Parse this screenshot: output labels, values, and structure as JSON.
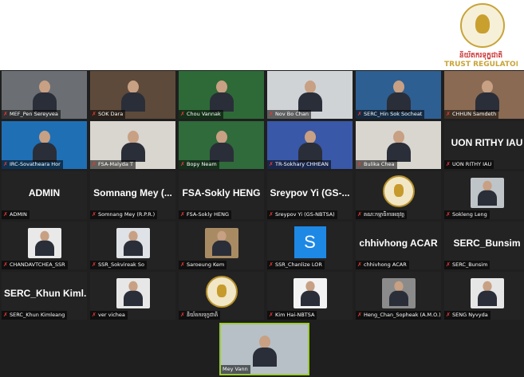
{
  "logo": {
    "kh_text": "និយ័តករទុក្ខជាតិ",
    "en_text": "TRUST REGULATOR",
    "brand_color": "#c8a43a"
  },
  "participants": [
    {
      "name": "MEF_Pen Sereyvea",
      "kind": "video",
      "bg": "#6b6f74"
    },
    {
      "name": "SOK Dara",
      "kind": "video",
      "bg": "#5e4a3a"
    },
    {
      "name": "Chou Vannak",
      "kind": "video",
      "bg": "#2e6a37"
    },
    {
      "name": "Nov Bo Chan",
      "kind": "video",
      "bg": "#cfd3d6"
    },
    {
      "name": "SERC_Hin Sok Socheat",
      "kind": "video",
      "bg": "#2e5f92"
    },
    {
      "name": "CHHUN Samdeth",
      "kind": "video",
      "bg": "#8a6a52"
    },
    {
      "name": "IRC-Sovatheara Hor",
      "kind": "video",
      "bg": "#1f6fb5"
    },
    {
      "name": "FSA-Malyda T",
      "kind": "video",
      "bg": "#d9d5cf"
    },
    {
      "name": "Bopy Neam",
      "kind": "video",
      "bg": "#2f6b3b"
    },
    {
      "name": "TR-Sokhary CHHEAN",
      "kind": "video",
      "bg": "#3a58a8"
    },
    {
      "name": "Bulika Chea",
      "kind": "video",
      "bg": "#d9d6d0"
    },
    {
      "name": "UON RITHY IAU",
      "kind": "text",
      "label": "UON RITHY IAU"
    },
    {
      "name": "ADMIN",
      "kind": "text",
      "label": "ADMIN"
    },
    {
      "name": "Somnang Mey (R.P.R.)",
      "kind": "text",
      "label": "Somnang Mey (..."
    },
    {
      "name": "FSA-Sokly HENG",
      "kind": "text",
      "label": "FSA-Sokly HENG"
    },
    {
      "name": "Sreypov Yi (GS-NBTSA)",
      "kind": "text",
      "label": "Sreypov Yi (GS-..."
    },
    {
      "name": "គណៈកម្មាធិការអនុវត្ត",
      "kind": "seal"
    },
    {
      "name": "Sokleng Leng",
      "kind": "avatar",
      "bg": "#bfc4c9"
    },
    {
      "name": "CHANDAVTCHEA_SSR",
      "kind": "avatar",
      "bg": "#e9e9e9"
    },
    {
      "name": "SSR_Sokvireak So",
      "kind": "avatar",
      "bg": "#dfe2e6"
    },
    {
      "name": "Saroeung Kem",
      "kind": "avatar",
      "bg": "#a98b63"
    },
    {
      "name": "SSR_Chanlize LOR",
      "kind": "letter",
      "label": "S"
    },
    {
      "name": "chhivhong ACAR",
      "kind": "text",
      "label": "chhivhong ACAR"
    },
    {
      "name": "SERC_Bunsim",
      "kind": "text",
      "label": "SERC_Bunsim"
    },
    {
      "name": "SERC_Khun Kimleang",
      "kind": "text",
      "label": "SERC_Khun Kiml..."
    },
    {
      "name": "ver vichea",
      "kind": "avatar",
      "bg": "#e7e7e7"
    },
    {
      "name": "និយ័តករទុក្ខជាតិ",
      "kind": "seal"
    },
    {
      "name": "Kim Hai-NBTSA",
      "kind": "avatar",
      "bg": "#f3f3f3"
    },
    {
      "name": "Heng_Chan_Sopheak (A.M.O.)",
      "kind": "avatar",
      "bg": "#8b8b8b"
    },
    {
      "name": "SENG Nyvyda",
      "kind": "avatar",
      "bg": "#e6e6e6"
    }
  ],
  "spotlight": {
    "name": "Mey Vann",
    "bg": "#b7c0c7"
  },
  "colors": {
    "grid_bg": "#1f1f1f",
    "tile_bg": "#232323",
    "muted_mic": "#e53935",
    "active_speaker": "#9acd32"
  }
}
